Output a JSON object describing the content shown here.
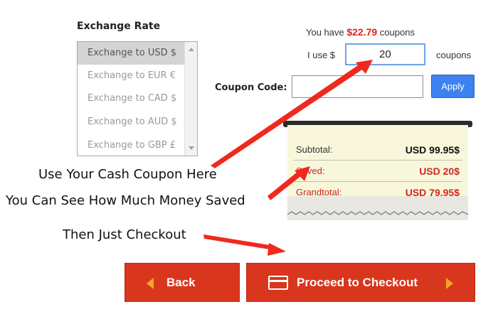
{
  "exchange": {
    "title": "Exchange Rate",
    "options": [
      {
        "label": "Exchange to USD $",
        "selected": true
      },
      {
        "label": "Exchange to EUR €",
        "selected": false
      },
      {
        "label": "Exchange to CAD $",
        "selected": false
      },
      {
        "label": "Exchange to AUD $",
        "selected": false
      },
      {
        "label": "Exchange to GBP £",
        "selected": false
      }
    ]
  },
  "coupons": {
    "you_have_prefix": "You have ",
    "you_have_amount": "$22.79",
    "you_have_suffix": " coupons",
    "i_use_label": "I use $",
    "amount_value": "20",
    "coupons_label": "coupons",
    "code_label": "Coupon Code:",
    "code_value": "",
    "apply_label": "Apply"
  },
  "receipt": {
    "subtotal_label": "Subtotal:",
    "subtotal_value": "USD 99.95$",
    "saved_label": "Saved:",
    "saved_value": "USD 20$",
    "grandtotal_label": "Grandtotal:",
    "grandtotal_value": "USD 79.95$"
  },
  "notes": {
    "coupon": "Use Your Cash Coupon Here",
    "saved": "You Can See How Much Money Saved",
    "checkout": "Then Just Checkout"
  },
  "buttons": {
    "back": "Back",
    "checkout": "Proceed to Checkout"
  },
  "colors": {
    "accent_red": "#d9361e",
    "apply_blue": "#3d82ee",
    "arrow_red": "#f0281e",
    "button_icon_orange": "#f5a623"
  }
}
